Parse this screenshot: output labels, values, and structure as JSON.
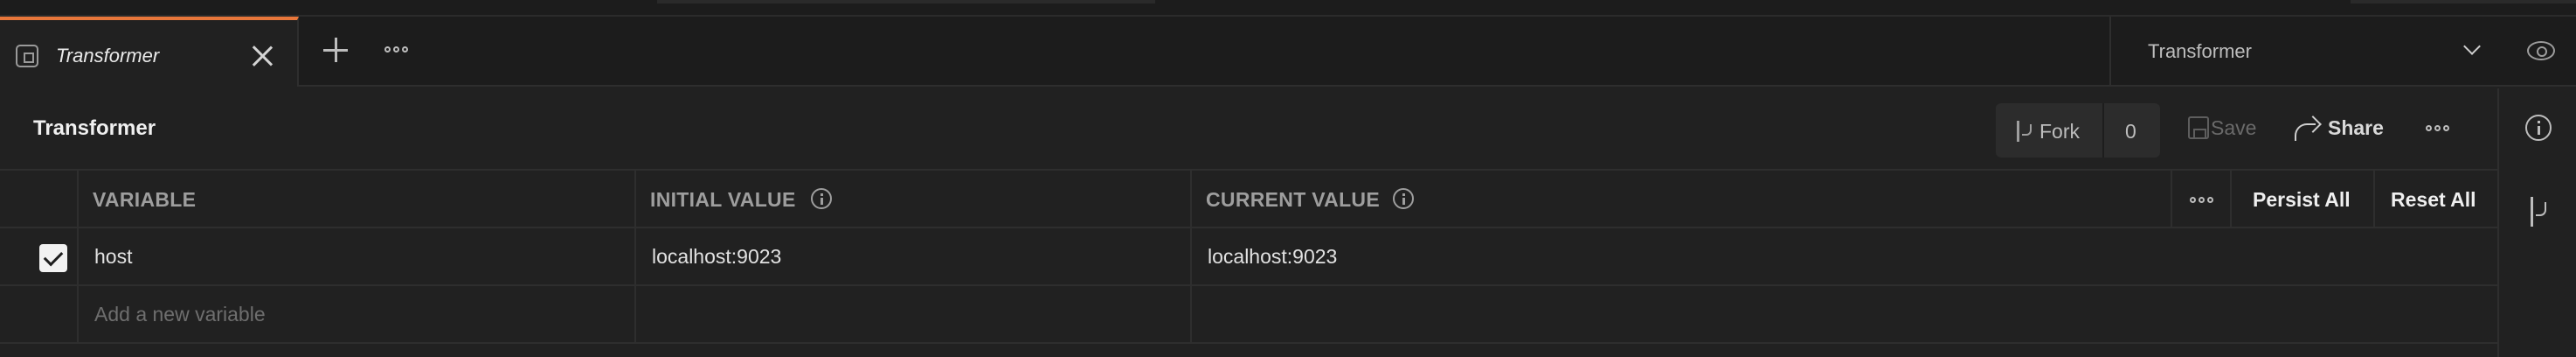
{
  "tab": {
    "label": "Transformer"
  },
  "environment_selector": {
    "selected": "Transformer"
  },
  "header": {
    "title": "Transformer",
    "fork_label": "Fork",
    "fork_count": "0",
    "save_label": "Save",
    "share_label": "Share"
  },
  "table": {
    "columns": {
      "variable": "VARIABLE",
      "initial_value": "INITIAL VALUE",
      "current_value": "CURRENT VALUE"
    },
    "actions": {
      "persist_all": "Persist All",
      "reset_all": "Reset All"
    },
    "rows": [
      {
        "checked": true,
        "variable": "host",
        "initial_value": "localhost:9023",
        "current_value": "localhost:9023"
      }
    ],
    "new_row_placeholder": "Add a new variable"
  }
}
